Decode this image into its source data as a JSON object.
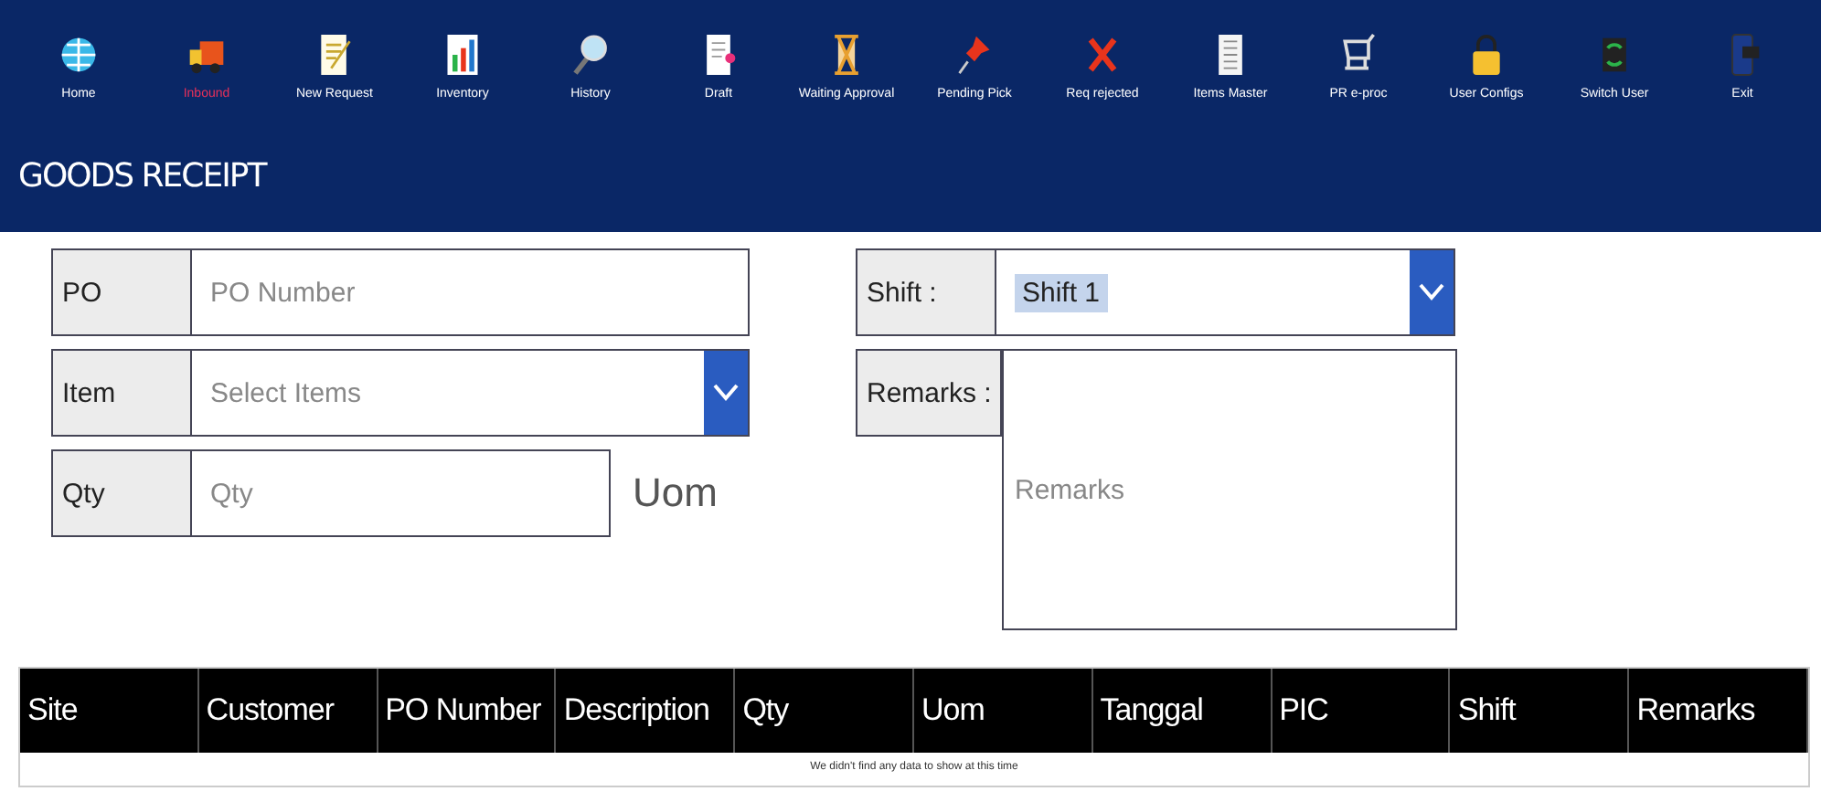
{
  "toolbar": [
    {
      "label": "Home",
      "kind": "globe",
      "selected": false
    },
    {
      "label": "Inbound",
      "kind": "truck",
      "selected": true
    },
    {
      "label": "New Request",
      "kind": "note",
      "selected": false
    },
    {
      "label": "Inventory",
      "kind": "chart",
      "selected": false
    },
    {
      "label": "History",
      "kind": "magnifier",
      "selected": false
    },
    {
      "label": "Draft",
      "kind": "document",
      "selected": false
    },
    {
      "label": "Waiting Approval",
      "kind": "hourglass",
      "selected": false
    },
    {
      "label": "Pending Pick",
      "kind": "pin",
      "selected": false
    },
    {
      "label": "Req rejected",
      "kind": "cross",
      "selected": false
    },
    {
      "label": "Items Master",
      "kind": "list",
      "selected": false
    },
    {
      "label": "PR e-proc",
      "kind": "cart",
      "selected": false
    },
    {
      "label": "User Configs",
      "kind": "lock",
      "selected": false
    },
    {
      "label": "Switch User",
      "kind": "switch",
      "selected": false
    },
    {
      "label": "Exit",
      "kind": "phone",
      "selected": false
    }
  ],
  "page_title": "GOODS RECEIPT",
  "form_left": [
    {
      "label": "PO",
      "placeholder": "PO Number",
      "kind": "text"
    },
    {
      "label": "Item",
      "placeholder": "Select Items",
      "kind": "dropdown"
    },
    {
      "label": "Qty",
      "placeholder": "Qty",
      "kind": "number",
      "unit": "Uom"
    }
  ],
  "shift": {
    "label": "Shift :",
    "value": "Shift 1"
  },
  "remarks": {
    "label": "Remarks :",
    "placeholder": "Remarks"
  },
  "table": {
    "columns": [
      "Site",
      "Customer",
      "PO Number",
      "Description",
      "Qty",
      "Uom",
      "Tanggal",
      "PIC",
      "Shift",
      "Remarks"
    ],
    "empty_message": "We didn't find any data to show at this time"
  }
}
